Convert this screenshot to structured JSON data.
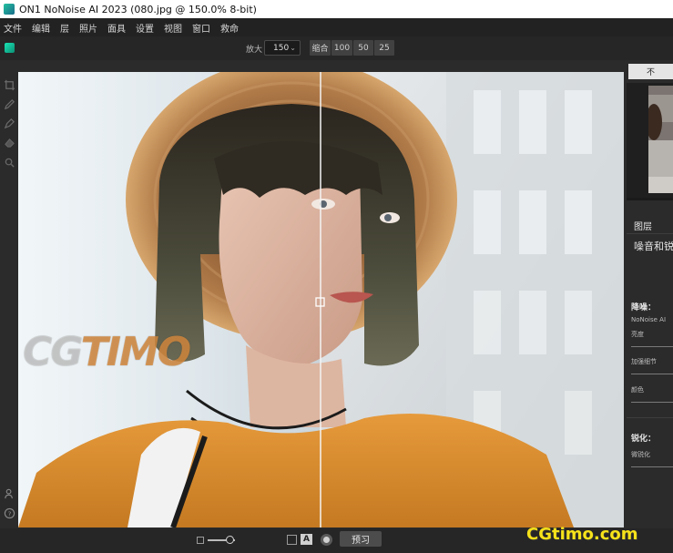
{
  "window": {
    "title": "ON1 NoNoise AI 2023 (080.jpg @ 150.0% 8-bit)"
  },
  "menu": [
    "文件",
    "编辑",
    "层",
    "照片",
    "面具",
    "设置",
    "视图",
    "窗口",
    "救命"
  ],
  "toolbar": {
    "zoom_label": "放大",
    "zoom_value": "150",
    "zoom_presets": [
      "缩合",
      "100",
      "50",
      "25"
    ]
  },
  "right_panel": {
    "tab_label": "不",
    "layers_header": "图层",
    "section_title": "噪音和锐",
    "noise_header": "降噪：",
    "noise_mode": "NoNoise AI",
    "luminance_label": "亮度",
    "enhance_detail_label": "加强细节",
    "color_label": "颜色",
    "sharpen_header": "锐化：",
    "sharpen_amount_label": "微锐化"
  },
  "bottom_bar": {
    "ab_label": "A",
    "preview_label": "预习"
  },
  "watermark": {
    "left": "CGTIMO",
    "right": "CGtimo.com"
  },
  "colors": {
    "titlebar_bg": "#ffffff",
    "app_bg": "#2b2b2b",
    "accent": "#1fd0a8"
  }
}
